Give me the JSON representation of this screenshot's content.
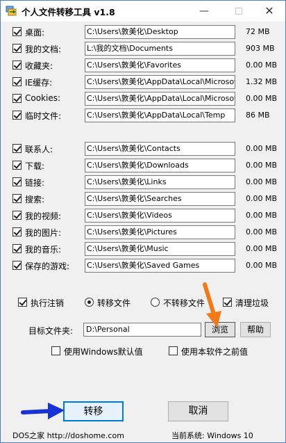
{
  "titlebar": {
    "title": "个人文件转移工具 v1.8",
    "minimize_icon": "minimize-icon",
    "maximize_icon": "maximize-icon",
    "close_icon": "close-icon"
  },
  "folders": [
    {
      "label": "桌面:",
      "checked": true,
      "path": "C:\\Users\\敦美化\\Desktop",
      "size": "72 MB"
    },
    {
      "label": "我的文档:",
      "checked": true,
      "path": "L:\\我的文档\\Documents",
      "size": "903 MB"
    },
    {
      "label": "收藏夹:",
      "checked": true,
      "path": "C:\\Users\\敦美化\\Favorites",
      "size": "0.00 MB"
    },
    {
      "label": "IE缓存:",
      "checked": true,
      "path": "C:\\Users\\敦美化\\AppData\\Local\\Microsoft\\",
      "size": "1.32 MB"
    },
    {
      "label": "Cookies:",
      "checked": true,
      "path": "C:\\Users\\敦美化\\AppData\\Local\\Microsoft\\",
      "size": "0.00 MB"
    },
    {
      "label": "临时文件:",
      "checked": true,
      "path": "C:\\Users\\敦美化\\AppData\\Local\\Temp",
      "size": "86 MB"
    },
    {
      "label": "联系人:",
      "checked": true,
      "path": "C:\\Users\\敦美化\\Contacts",
      "size": "0.00 MB"
    },
    {
      "label": "下载:",
      "checked": true,
      "path": "C:\\Users\\敦美化\\Downloads",
      "size": "0.00 MB"
    },
    {
      "label": "链接:",
      "checked": true,
      "path": "C:\\Users\\敦美化\\Links",
      "size": "0.00 MB"
    },
    {
      "label": "搜索:",
      "checked": true,
      "path": "C:\\Users\\敦美化\\Searches",
      "size": "0.00 MB"
    },
    {
      "label": "我的视频:",
      "checked": true,
      "path": "C:\\Users\\敦美化\\Videos",
      "size": "0.00 MB"
    },
    {
      "label": "我的图片:",
      "checked": true,
      "path": "C:\\Users\\敦美化\\Pictures",
      "size": "0.00 MB"
    },
    {
      "label": "我的音乐:",
      "checked": true,
      "path": "C:\\Users\\敦美化\\Music",
      "size": "0.00 MB"
    },
    {
      "label": "保存的游戏:",
      "checked": true,
      "path": "C:\\Users\\敦美化\\Saved Games",
      "size": "0.00 MB"
    }
  ],
  "options": {
    "logoff_label": "执行注销",
    "logoff_checked": true,
    "transfer_files_label": "转移文件",
    "transfer_files_selected": true,
    "no_transfer_label": "不转移文件",
    "no_transfer_selected": false,
    "clean_label": "清理垃圾",
    "clean_checked": true
  },
  "target": {
    "label": "目标文件夹:",
    "value": "D:\\Personal",
    "browse_label": "浏览",
    "help_label": "帮助",
    "use_windows_default_label": "使用Windows默认值",
    "use_windows_default_checked": false,
    "use_previous_label": "使用本软件之前值",
    "use_previous_checked": false
  },
  "actions": {
    "transfer_label": "转移",
    "cancel_label": "取消"
  },
  "footer": {
    "site": "DOS之家 http://doshome.com",
    "system": "当前系统:  Windows 10"
  },
  "colors": {
    "accent": "#0078d7",
    "orange_arrow": "#f07a1a",
    "blue_arrow": "#1733d8"
  }
}
